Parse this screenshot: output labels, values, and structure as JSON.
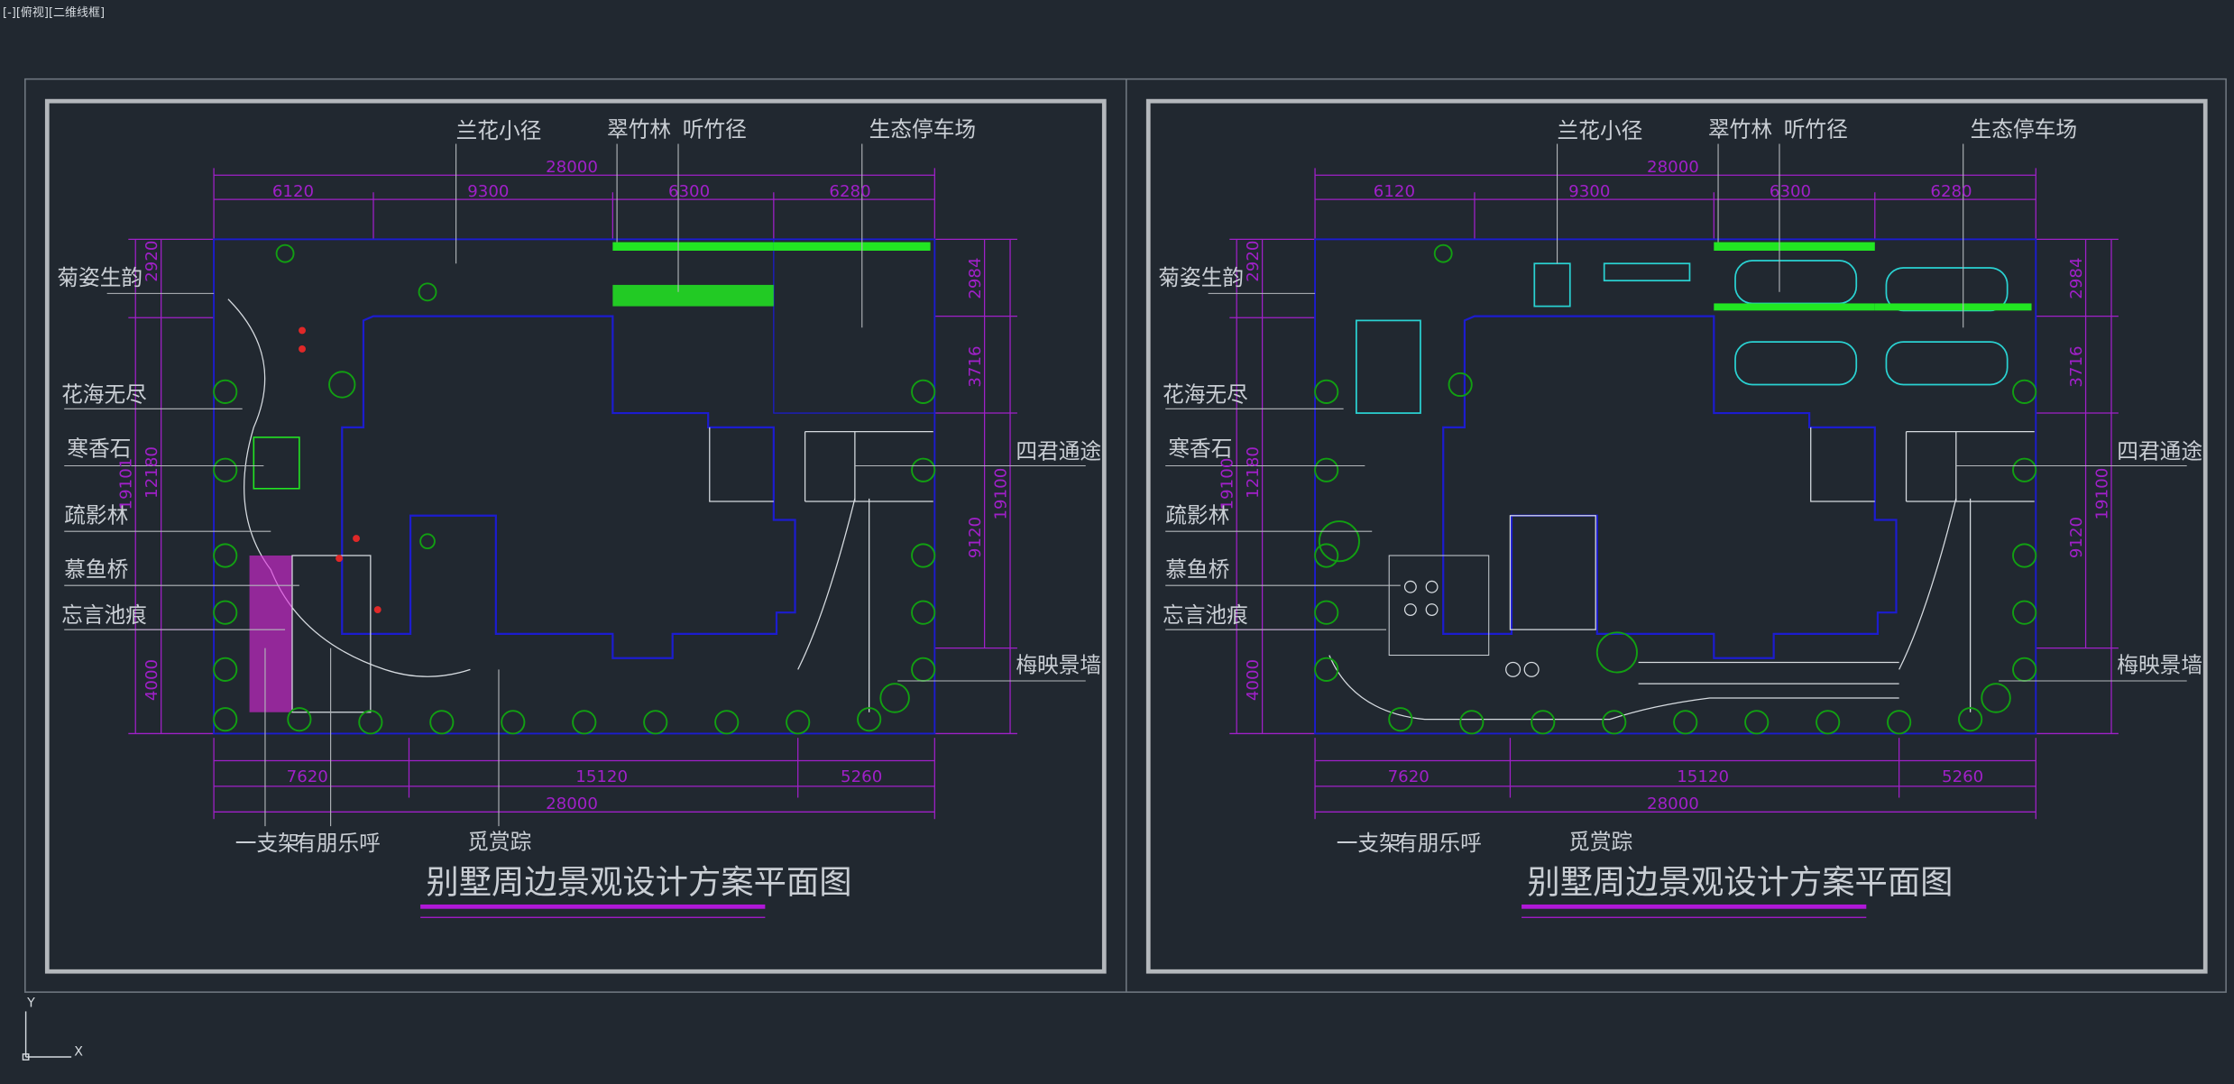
{
  "viewport": {
    "label": "[-][俯视][二维线框]"
  },
  "axes": {
    "y": "Y",
    "x": "X"
  },
  "colors": {
    "background": "#212830",
    "frame": "#b4b8bc",
    "viewport_border": "#6f7780",
    "dimension": "#a020c8",
    "wall": "#1c1ccf",
    "tree": "#12a012",
    "green": "#22e622",
    "cyan": "#2ad2d2",
    "white_line": "#d6dbe0",
    "magenta": "#e028e0",
    "red": "#e02828",
    "title_underline": "#b018d8"
  },
  "drawings": [
    {
      "id": "left",
      "labels": {
        "left": [
          "菊姿生韵",
          "花海无尽",
          "寒香石",
          "疏影林",
          "慕鱼桥",
          "忘言池痕"
        ],
        "top": [
          "兰花小径",
          "翠竹林",
          "听竹径",
          "生态停车场"
        ],
        "right": [
          "四君通途",
          "梅映景墙"
        ],
        "bottom": [
          "一支架",
          "有朋乐呼",
          "觅赏踪"
        ]
      },
      "dims": {
        "top_total": "28000",
        "top_parts": [
          "6120",
          "9300",
          "6300",
          "6280"
        ],
        "bottom_parts": [
          "7620",
          "15120",
          "5260"
        ],
        "bottom_total": "28000",
        "left_outer": "19101",
        "left_parts": [
          "2920",
          "12180",
          "4000"
        ],
        "right_outer": "19100",
        "right_parts": [
          "2984",
          "3716",
          "9120"
        ]
      },
      "title": "别墅周边景观设计方案平面图"
    },
    {
      "id": "right",
      "labels": {
        "left": [
          "菊姿生韵",
          "花海无尽",
          "寒香石",
          "疏影林",
          "慕鱼桥",
          "忘言池痕"
        ],
        "top": [
          "兰花小径",
          "翠竹林",
          "听竹径",
          "生态停车场"
        ],
        "right": [
          "四君通途",
          "梅映景墙"
        ],
        "bottom": [
          "一支架",
          "有朋乐呼",
          "觅赏踪"
        ]
      },
      "dims": {
        "top_total": "28000",
        "top_parts": [
          "6120",
          "9300",
          "6300",
          "6280"
        ],
        "bottom_parts": [
          "7620",
          "15120",
          "5260"
        ],
        "bottom_total": "28000",
        "left_outer": "19100",
        "left_parts": [
          "2920",
          "12180",
          "4000"
        ],
        "right_outer": "19100",
        "right_parts": [
          "2984",
          "3716",
          "9120"
        ]
      },
      "title": "别墅周边景观设计方案平面图"
    }
  ]
}
